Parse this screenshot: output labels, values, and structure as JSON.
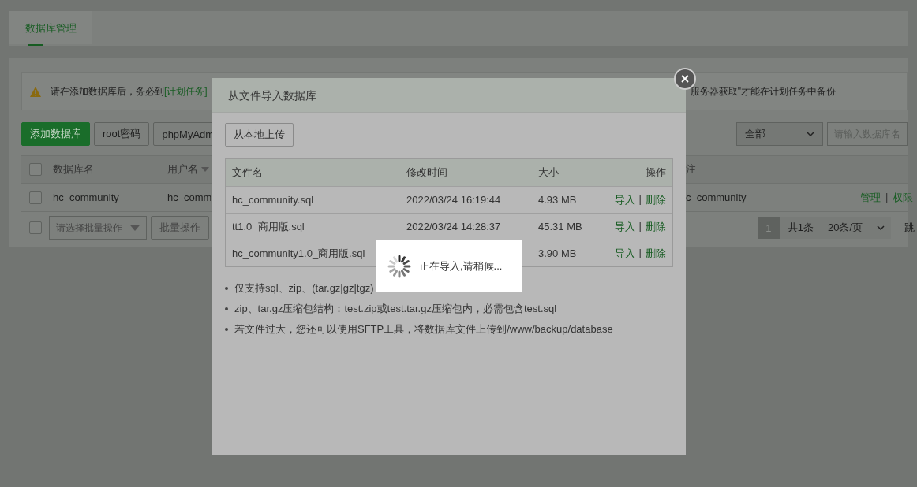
{
  "tabs": [
    {
      "label": "数据库管理",
      "selected": true
    }
  ],
  "notice": {
    "text": "请在添加数据库后，务必到",
    "link": "[计划任务]",
    "text_right": "服务器获取\"才能在计划任务中备份"
  },
  "toolbar": {
    "buttons": [
      {
        "label": "添加数据库",
        "kind": "primary"
      },
      {
        "label": "root密码",
        "kind": "default"
      },
      {
        "label": "phpMyAdm",
        "kind": "default"
      }
    ],
    "filter": "全部",
    "search": {
      "placeholder": "请输入数据库名"
    }
  },
  "table": {
    "columns": [
      {
        "label": "数据库名"
      },
      {
        "label": "用户名",
        "sortable": true
      }
    ],
    "column_right": "注",
    "select_all_checked": false,
    "separator": "|",
    "rows": [
      {
        "checked": false,
        "name": "hc_community",
        "user": "hc_comm",
        "note": "c_community",
        "actions": [
          "管理",
          "权限"
        ]
      }
    ]
  },
  "footer": {
    "select_all_checked": false,
    "batch_select": "请选择批量操作",
    "batch_button": "批量操作",
    "page": "1",
    "total": "共1条",
    "per_page": "20条/页",
    "jump": "跳"
  },
  "dialog": {
    "title": "从文件导入数据库",
    "upload_button": "从本地上传",
    "columns": [
      "文件名",
      "修改时间",
      "大小",
      "操作"
    ],
    "files": [
      {
        "name": "hc_community.sql",
        "time": "2022/03/24 16:19:44",
        "size": "4.93 MB",
        "actions": [
          "导入",
          "删除"
        ]
      },
      {
        "name": "tt1.0_商用版.sql",
        "time": "2022/03/24 14:28:37",
        "size": "45.31 MB",
        "actions": [
          "导入",
          "删除"
        ]
      },
      {
        "name": "hc_community1.0_商用版.sql",
        "size": "3.90 MB",
        "actions": [
          "导入",
          "删除"
        ]
      }
    ],
    "separator": "|",
    "notes": [
      "仅支持sql、zip、(tar.gz|gz|tgz)",
      "zip、tar.gz压缩包结构：test.zip或test.tar.gz压缩包内，必需包含test.sql",
      "若文件过大，您还可以使用SFTP工具，将数据库文件上传到/www/backup/database"
    ]
  },
  "loading": {
    "text": "正在导入,请稍候..."
  }
}
